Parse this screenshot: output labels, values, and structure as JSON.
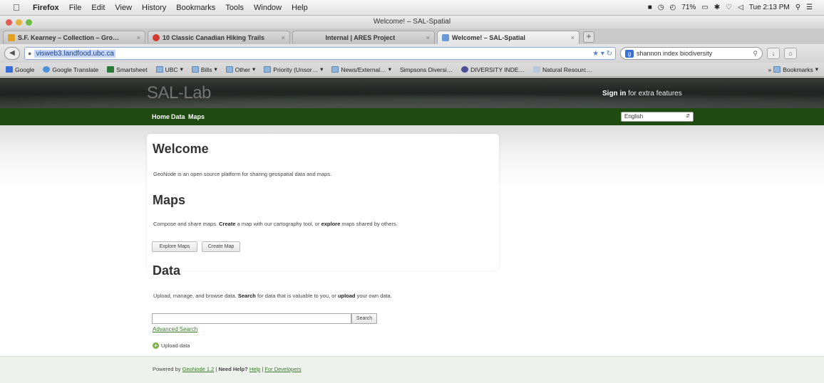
{
  "menubar": {
    "app": "Firefox",
    "items": [
      "File",
      "Edit",
      "View",
      "History",
      "Bookmarks",
      "Tools",
      "Window",
      "Help"
    ],
    "status": {
      "battery": "71%",
      "clock": "Tue 2:13 PM"
    }
  },
  "window": {
    "title": "Welcome! – SAL-Spatial"
  },
  "tabs": [
    {
      "label": "S.F. Kearney – Collection – Gro…",
      "color": "#e0a020"
    },
    {
      "label": "10 Classic Canadian Hiking Trails",
      "color": "#d23a2e"
    },
    {
      "label": "Internal | ARES Project",
      "color": "#c9c9c9"
    },
    {
      "label": "Welcome! – SAL-Spatial",
      "color": "#6a9ad4"
    }
  ],
  "url": "visweb3.landfood.ubc.ca",
  "search": {
    "value": "shannon index biodiversity"
  },
  "bookmarks": [
    "Google",
    "Google Translate",
    "Smartsheet",
    "UBC",
    "Bills",
    "Other",
    "Priority (Unsor…",
    "News/External…",
    "Simpsons Diversi…",
    "DIVERSITY INDE…",
    "Natural Resourc…"
  ],
  "bookmarks_menu": "Bookmarks",
  "header": {
    "logo": "SAL-Lab",
    "signin_bold": "Sign in",
    "signin_rest": " for extra features"
  },
  "nav": {
    "home": "Home",
    "data": "Data",
    "maps": "Maps",
    "language": "English"
  },
  "welcome": {
    "title": "Welcome",
    "text": "GeoNode is an open source platform for sharing geospatial data and maps."
  },
  "maps": {
    "title": "Maps",
    "text_pre": "Compose and share maps. ",
    "text_b1": "Create",
    "text_mid": " a map with our cartography tool, or ",
    "text_b2": "explore",
    "text_post": " maps shared by others.",
    "explore_btn": "Explore Maps",
    "create_btn": "Create Map"
  },
  "data": {
    "title": "Data",
    "text_pre": "Upload, manage, and browse data. ",
    "text_b1": "Search",
    "text_mid": " for data that is valuable to you, or ",
    "text_b2": "upload",
    "text_post": " your own data.",
    "search_btn": "Search",
    "advanced": "Advanced Search",
    "upload": "Upload data"
  },
  "footer": {
    "pre": "Powered by ",
    "geonode": "GeoNode 1.2",
    "sep1": " | ",
    "help_b": "Need Help?",
    "help": "Help",
    "sep2": " | ",
    "dev": "For Developers"
  }
}
